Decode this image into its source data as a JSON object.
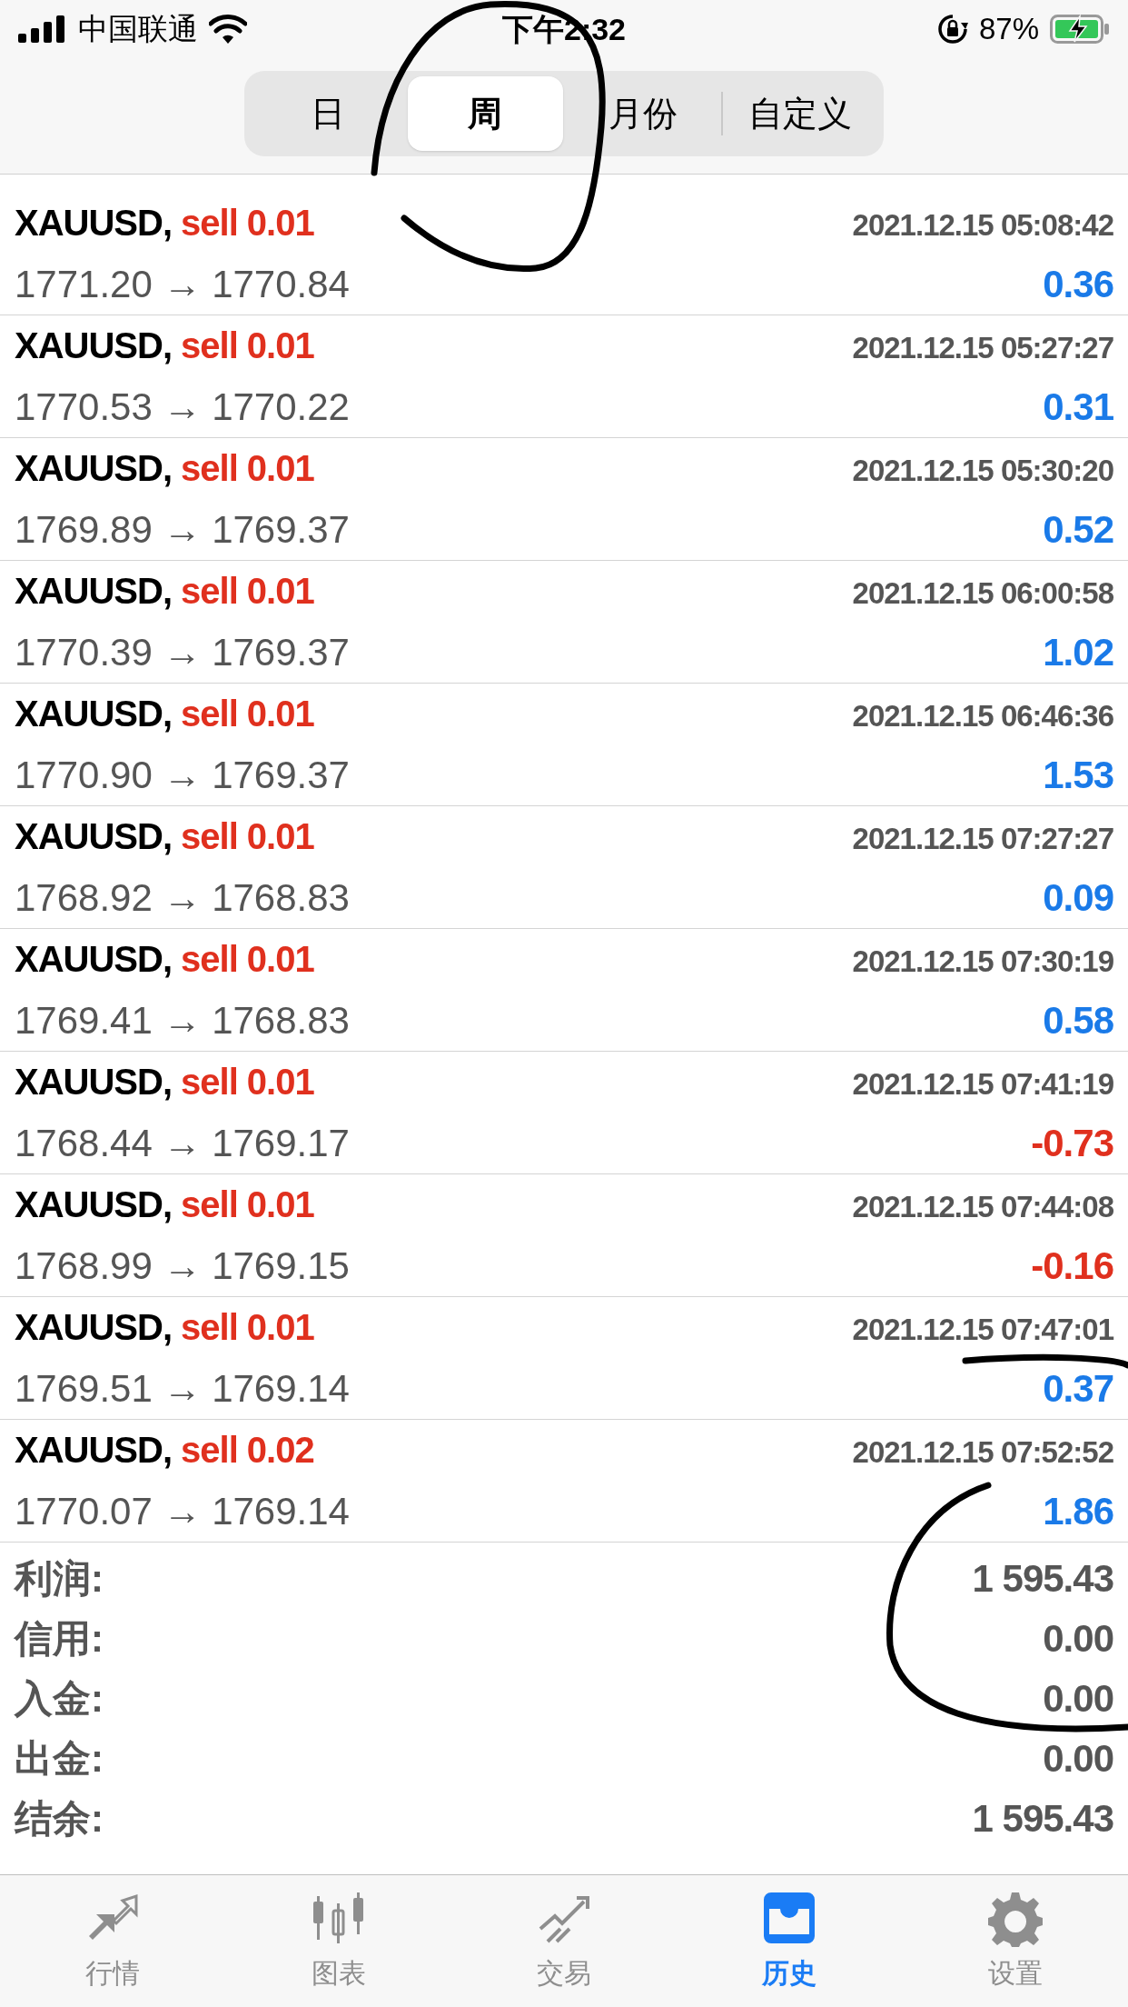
{
  "status_bar": {
    "carrier": "中国联通",
    "time": "下午2:32",
    "battery": "87%"
  },
  "period_tabs": [
    {
      "label": "日",
      "selected": false
    },
    {
      "label": "周",
      "selected": true
    },
    {
      "label": "月份",
      "selected": false
    },
    {
      "label": "自定义",
      "selected": false
    }
  ],
  "deals": [
    {
      "symbol": "XAUUSD,",
      "deal": "sell 0.01",
      "time": "2021.12.15 05:08:42",
      "prices": "1771.20 → 1770.84",
      "profit": "0.36",
      "loss": false
    },
    {
      "symbol": "XAUUSD,",
      "deal": "sell 0.01",
      "time": "2021.12.15 05:27:27",
      "prices": "1770.53 → 1770.22",
      "profit": "0.31",
      "loss": false
    },
    {
      "symbol": "XAUUSD,",
      "deal": "sell 0.01",
      "time": "2021.12.15 05:30:20",
      "prices": "1769.89 → 1769.37",
      "profit": "0.52",
      "loss": false
    },
    {
      "symbol": "XAUUSD,",
      "deal": "sell 0.01",
      "time": "2021.12.15 06:00:58",
      "prices": "1770.39 → 1769.37",
      "profit": "1.02",
      "loss": false
    },
    {
      "symbol": "XAUUSD,",
      "deal": "sell 0.01",
      "time": "2021.12.15 06:46:36",
      "prices": "1770.90 → 1769.37",
      "profit": "1.53",
      "loss": false
    },
    {
      "symbol": "XAUUSD,",
      "deal": "sell 0.01",
      "time": "2021.12.15 07:27:27",
      "prices": "1768.92 → 1768.83",
      "profit": "0.09",
      "loss": false
    },
    {
      "symbol": "XAUUSD,",
      "deal": "sell 0.01",
      "time": "2021.12.15 07:30:19",
      "prices": "1769.41 → 1768.83",
      "profit": "0.58",
      "loss": false
    },
    {
      "symbol": "XAUUSD,",
      "deal": "sell 0.01",
      "time": "2021.12.15 07:41:19",
      "prices": "1768.44 → 1769.17",
      "profit": "-0.73",
      "loss": true
    },
    {
      "symbol": "XAUUSD,",
      "deal": "sell 0.01",
      "time": "2021.12.15 07:44:08",
      "prices": "1768.99 → 1769.15",
      "profit": "-0.16",
      "loss": true
    },
    {
      "symbol": "XAUUSD,",
      "deal": "sell 0.01",
      "time": "2021.12.15 07:47:01",
      "prices": "1769.51 → 1769.14",
      "profit": "0.37",
      "loss": false
    },
    {
      "symbol": "XAUUSD,",
      "deal": "sell 0.02",
      "time": "2021.12.15 07:52:52",
      "prices": "1770.07 → 1769.14",
      "profit": "1.86",
      "loss": false
    }
  ],
  "summary": [
    {
      "label": "利润:",
      "value": "1 595.43"
    },
    {
      "label": "信用:",
      "value": "0.00"
    },
    {
      "label": "入金:",
      "value": "0.00"
    },
    {
      "label": "出金:",
      "value": "0.00"
    },
    {
      "label": "结余:",
      "value": "1 595.43"
    }
  ],
  "tab_bar": [
    {
      "kind": "quotes",
      "label": "行情",
      "selected": false
    },
    {
      "kind": "chart",
      "label": "图表",
      "selected": false
    },
    {
      "kind": "trade",
      "label": "交易",
      "selected": false
    },
    {
      "kind": "history",
      "label": "历史",
      "selected": true
    },
    {
      "kind": "settings",
      "label": "设置",
      "selected": false
    }
  ]
}
